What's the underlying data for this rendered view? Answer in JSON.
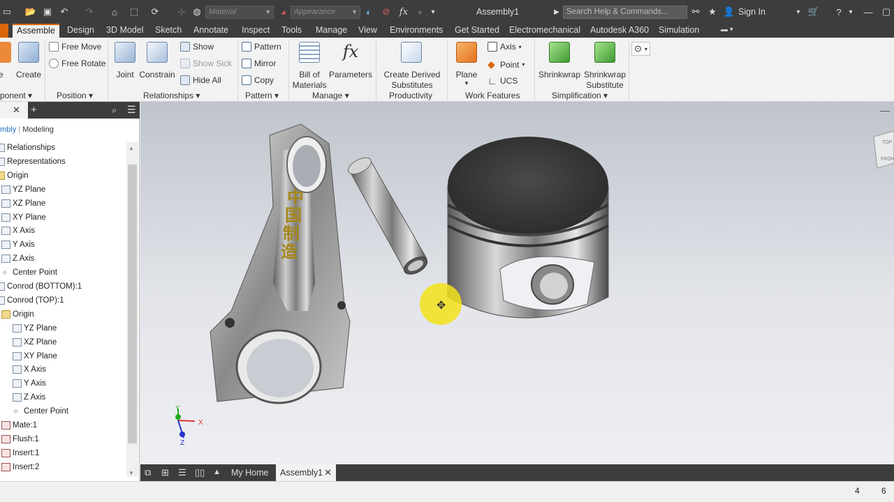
{
  "qat": {
    "material": "Material",
    "appearance": "Appearance",
    "title": "Assembly1",
    "search_placeholder": "Search Help & Commands...",
    "signin": "Sign In"
  },
  "tabs": [
    "Assemble",
    "Design",
    "3D Model",
    "Sketch",
    "Annotate",
    "Inspect",
    "Tools",
    "Manage",
    "View",
    "Environments",
    "Get Started",
    "Electromechanical",
    "Autodesk A360",
    "Simulation"
  ],
  "ribbon": {
    "component_cut": "ce",
    "create": "Create",
    "free_move": "Free Move",
    "free_rotate": "Free Rotate",
    "joint": "Joint",
    "constrain": "Constrain",
    "show": "Show",
    "show_sick": "Show Sick",
    "hide_all": "Hide All",
    "pattern": "Pattern",
    "mirror": "Mirror",
    "copy": "Copy",
    "bom_1": "Bill of",
    "bom_2": "Materials",
    "parameters": "Parameters",
    "cds_1": "Create Derived",
    "cds_2": "Substitutes",
    "plane": "Plane",
    "axis": "Axis",
    "point": "Point",
    "ucs": "UCS",
    "shrinkwrap": "Shrinkwrap",
    "sws_1": "Shrinkwrap",
    "sws_2": "Substitute",
    "g_component": "ponent",
    "g_position": "Position",
    "g_relationships": "Relationships",
    "g_pattern": "Pattern",
    "g_manage": "Manage",
    "g_productivity": "Productivity",
    "g_work": "Work Features",
    "g_simplification": "Simplification"
  },
  "browser": {
    "mode_assembly": "mbly",
    "mode_modeling": "Modeling",
    "items": [
      "Relationships",
      "Representations",
      "Origin",
      "YZ Plane",
      "XZ Plane",
      "XY Plane",
      "X Axis",
      "Y Axis",
      "Z Axis",
      "Center Point",
      "Conrod (BOTTOM):1",
      "Conrod (TOP):1",
      "Origin",
      "YZ Plane",
      "XZ Plane",
      "XY Plane",
      "X Axis",
      "Y Axis",
      "Z Axis",
      "Center Point",
      "Mate:1",
      "Flush:1",
      "Insert:1",
      "Insert:2"
    ]
  },
  "viewport": {
    "engraving": "中国制造",
    "viewcube_top": "TOP",
    "viewcube_front": "FRONT",
    "axis_x": "X",
    "axis_y": "Y",
    "axis_z": "Z"
  },
  "doctabs": {
    "home": "My Home",
    "doc": "Assembly1"
  },
  "status": {
    "n1": "4",
    "n2": "6"
  },
  "colors": {
    "accent": "#d9660b",
    "dark_bar": "#3d3d3d",
    "cursor_highlight": "#f3e21a"
  }
}
